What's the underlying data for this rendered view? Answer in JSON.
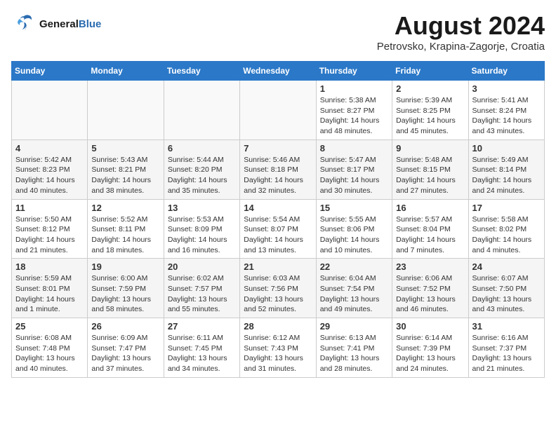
{
  "logo": {
    "line1": "General",
    "line2": "Blue"
  },
  "header": {
    "month": "August 2024",
    "location": "Petrovsko, Krapina-Zagorje, Croatia"
  },
  "weekdays": [
    "Sunday",
    "Monday",
    "Tuesday",
    "Wednesday",
    "Thursday",
    "Friday",
    "Saturday"
  ],
  "weeks": [
    [
      {
        "day": "",
        "info": ""
      },
      {
        "day": "",
        "info": ""
      },
      {
        "day": "",
        "info": ""
      },
      {
        "day": "",
        "info": ""
      },
      {
        "day": "1",
        "info": "Sunrise: 5:38 AM\nSunset: 8:27 PM\nDaylight: 14 hours and 48 minutes."
      },
      {
        "day": "2",
        "info": "Sunrise: 5:39 AM\nSunset: 8:25 PM\nDaylight: 14 hours and 45 minutes."
      },
      {
        "day": "3",
        "info": "Sunrise: 5:41 AM\nSunset: 8:24 PM\nDaylight: 14 hours and 43 minutes."
      }
    ],
    [
      {
        "day": "4",
        "info": "Sunrise: 5:42 AM\nSunset: 8:23 PM\nDaylight: 14 hours and 40 minutes."
      },
      {
        "day": "5",
        "info": "Sunrise: 5:43 AM\nSunset: 8:21 PM\nDaylight: 14 hours and 38 minutes."
      },
      {
        "day": "6",
        "info": "Sunrise: 5:44 AM\nSunset: 8:20 PM\nDaylight: 14 hours and 35 minutes."
      },
      {
        "day": "7",
        "info": "Sunrise: 5:46 AM\nSunset: 8:18 PM\nDaylight: 14 hours and 32 minutes."
      },
      {
        "day": "8",
        "info": "Sunrise: 5:47 AM\nSunset: 8:17 PM\nDaylight: 14 hours and 30 minutes."
      },
      {
        "day": "9",
        "info": "Sunrise: 5:48 AM\nSunset: 8:15 PM\nDaylight: 14 hours and 27 minutes."
      },
      {
        "day": "10",
        "info": "Sunrise: 5:49 AM\nSunset: 8:14 PM\nDaylight: 14 hours and 24 minutes."
      }
    ],
    [
      {
        "day": "11",
        "info": "Sunrise: 5:50 AM\nSunset: 8:12 PM\nDaylight: 14 hours and 21 minutes."
      },
      {
        "day": "12",
        "info": "Sunrise: 5:52 AM\nSunset: 8:11 PM\nDaylight: 14 hours and 18 minutes."
      },
      {
        "day": "13",
        "info": "Sunrise: 5:53 AM\nSunset: 8:09 PM\nDaylight: 14 hours and 16 minutes."
      },
      {
        "day": "14",
        "info": "Sunrise: 5:54 AM\nSunset: 8:07 PM\nDaylight: 14 hours and 13 minutes."
      },
      {
        "day": "15",
        "info": "Sunrise: 5:55 AM\nSunset: 8:06 PM\nDaylight: 14 hours and 10 minutes."
      },
      {
        "day": "16",
        "info": "Sunrise: 5:57 AM\nSunset: 8:04 PM\nDaylight: 14 hours and 7 minutes."
      },
      {
        "day": "17",
        "info": "Sunrise: 5:58 AM\nSunset: 8:02 PM\nDaylight: 14 hours and 4 minutes."
      }
    ],
    [
      {
        "day": "18",
        "info": "Sunrise: 5:59 AM\nSunset: 8:01 PM\nDaylight: 14 hours and 1 minute."
      },
      {
        "day": "19",
        "info": "Sunrise: 6:00 AM\nSunset: 7:59 PM\nDaylight: 13 hours and 58 minutes."
      },
      {
        "day": "20",
        "info": "Sunrise: 6:02 AM\nSunset: 7:57 PM\nDaylight: 13 hours and 55 minutes."
      },
      {
        "day": "21",
        "info": "Sunrise: 6:03 AM\nSunset: 7:56 PM\nDaylight: 13 hours and 52 minutes."
      },
      {
        "day": "22",
        "info": "Sunrise: 6:04 AM\nSunset: 7:54 PM\nDaylight: 13 hours and 49 minutes."
      },
      {
        "day": "23",
        "info": "Sunrise: 6:06 AM\nSunset: 7:52 PM\nDaylight: 13 hours and 46 minutes."
      },
      {
        "day": "24",
        "info": "Sunrise: 6:07 AM\nSunset: 7:50 PM\nDaylight: 13 hours and 43 minutes."
      }
    ],
    [
      {
        "day": "25",
        "info": "Sunrise: 6:08 AM\nSunset: 7:48 PM\nDaylight: 13 hours and 40 minutes."
      },
      {
        "day": "26",
        "info": "Sunrise: 6:09 AM\nSunset: 7:47 PM\nDaylight: 13 hours and 37 minutes."
      },
      {
        "day": "27",
        "info": "Sunrise: 6:11 AM\nSunset: 7:45 PM\nDaylight: 13 hours and 34 minutes."
      },
      {
        "day": "28",
        "info": "Sunrise: 6:12 AM\nSunset: 7:43 PM\nDaylight: 13 hours and 31 minutes."
      },
      {
        "day": "29",
        "info": "Sunrise: 6:13 AM\nSunset: 7:41 PM\nDaylight: 13 hours and 28 minutes."
      },
      {
        "day": "30",
        "info": "Sunrise: 6:14 AM\nSunset: 7:39 PM\nDaylight: 13 hours and 24 minutes."
      },
      {
        "day": "31",
        "info": "Sunrise: 6:16 AM\nSunset: 7:37 PM\nDaylight: 13 hours and 21 minutes."
      }
    ]
  ]
}
